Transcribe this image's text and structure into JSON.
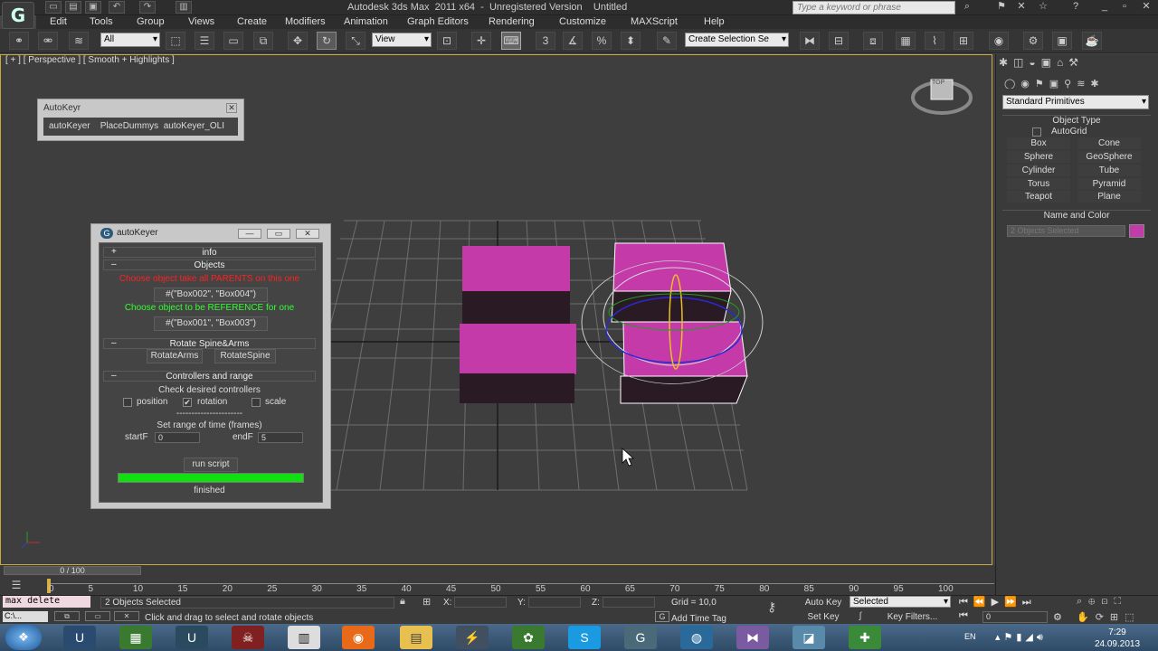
{
  "title": {
    "text": "Autodesk 3ds Max  2011 x64  -  Unregistered Version    Untitled",
    "search_placeholder": "Type a keyword or phrase"
  },
  "menu": [
    "Edit",
    "Tools",
    "Group",
    "Views",
    "Create",
    "Modifiers",
    "Animation",
    "Graph Editors",
    "Rendering",
    "Customize",
    "MAXScript",
    "Help"
  ],
  "toolbar": {
    "filter_value": "All",
    "refcoord_value": "View",
    "named_selection": "Create Selection Se",
    "snaps_label": "3",
    "percent_label": "%"
  },
  "viewport": {
    "label": "[ + ] [ Perspective ] [ Smooth + Highlights ]",
    "viewcube_label": "TOP"
  },
  "autokeyer_mini": {
    "title": "AutoKeyr",
    "buttons": "autoKeyer    PlaceDummys  autoKeyer_OLI"
  },
  "dialog": {
    "title": "autoKeyer",
    "info_label": "info",
    "info_sign": "+",
    "objects_label": "Objects",
    "minus": "–",
    "choose_pick": "Choose object take all PARENTS on this one",
    "pick_value": "#(\"Box002\", \"Box004\")",
    "choose_ref": "Choose object to be REFERENCE for one",
    "ref_value": "#(\"Box001\", \"Box003\")",
    "rotate_label": "Rotate Spine&Arms",
    "rotate_arms": "RotateArms",
    "rotate_spine": "RotateSpine",
    "controllers_label": "Controllers and range",
    "check_desired": "Check desired controllers",
    "position": "position",
    "rotation": "rotation",
    "scale": "scale",
    "check_mark": "✔",
    "separator": "----------------------",
    "set_range": "Set range of time (frames)",
    "start_label": "startF",
    "start_value": "0",
    "end_label": "endF",
    "end_value": "5",
    "run_script": "run script",
    "status": "finished",
    "progress": 1.0
  },
  "command_panel": {
    "primitives_value": "Standard Primitives",
    "object_type_label": "Object Type",
    "autogrid_label": "AutoGrid",
    "buttons": [
      "Box",
      "Cone",
      "Sphere",
      "GeoSphere",
      "Cylinder",
      "Tube",
      "Torus",
      "Pyramid",
      "Teapot",
      "Plane"
    ],
    "name_color_label": "Name and Color",
    "name_value": "2 Objects Selected",
    "color": "#c03ca8"
  },
  "timeline": {
    "slider_label": "0 / 100",
    "ticks": [
      "0",
      "5",
      "10",
      "15",
      "20",
      "25",
      "30",
      "35",
      "40",
      "45",
      "50",
      "55",
      "60",
      "65",
      "70",
      "75",
      "80",
      "85",
      "90",
      "95",
      "100"
    ]
  },
  "status": {
    "maxscript_listener": "max delete",
    "selection_text": "2 Objects Selected",
    "prompt": "Click and drag to select and rotate objects",
    "x_label": "X:",
    "y_label": "Y:",
    "z_label": "Z:",
    "grid": "Grid = 10,0",
    "add_time_tag": "Add Time Tag",
    "auto_key": "Auto Key",
    "set_key": "Set Key",
    "key_mode_value": "Selected",
    "key_filters": "Key Filters...",
    "frame_value": "0"
  },
  "taskbar": {
    "lang": "EN",
    "time": "7:29",
    "date": "24.09.2013"
  },
  "colors": {
    "box_top": "#c33aa8",
    "box_side": "#2a1a24",
    "progress": "#10e010",
    "red_text": "#ff2020",
    "green_text": "#30ff30"
  }
}
